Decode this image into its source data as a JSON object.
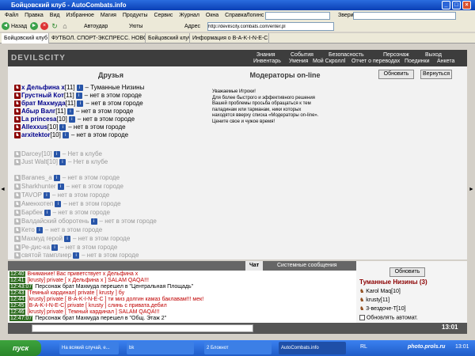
{
  "window": {
    "title": "Бойцовский клуб - AutoCombats.info"
  },
  "menu": [
    "Файл",
    "Правка",
    "Вид",
    "Избранное",
    "Магия",
    "Продукты",
    "Сервис",
    "Журнал",
    "Окна",
    "Справка"
  ],
  "toolbar": {
    "back": "Назад",
    "autoheroes": "Автоудар",
    "utoty": "Уюты",
    "address_label": "Адрес",
    "address_value": "http://devilscity.combats.com/enter.pl",
    "logins_label": "Логинс",
    "zveri_label": "Звери:"
  },
  "tabs": [
    "Бойцовский клуб",
    "ФУТБОЛ. СПОРТ-ЭКСПРЕСС. НОВОС...",
    "Бойцовский клуб",
    "Информация о B-A-K-I-N-E-C"
  ],
  "game": {
    "logo": "DEVILSCITY",
    "nav_top": [
      "Знания",
      "События",
      "Безопасность",
      "Персонаж",
      "Выход"
    ],
    "nav_bottom": [
      "Инвентарь",
      "Умения",
      "Мой Скроллl",
      "Отчет о переводах",
      "Поединки",
      "Анкета"
    ],
    "refresh": "Обновить",
    "back": "Вернуться",
    "friends_title": "Друзья",
    "moderators_title": "Модераторы on-line",
    "moderators_text": [
      "Уважаемые Игроки!",
      "Для более быстрого и эффективного решения",
      "Вашей проблемы просьба обращаться к тем",
      "паладинам или тарманам, ники которых",
      "находятся вверху списка «Модераторы on-line».",
      "Цените свое и чужое время!"
    ],
    "friends": [
      {
        "name": "x Дельфина x",
        "level": "[11]",
        "status": "– Туманные Низины",
        "online": true
      },
      {
        "name": "Грустный Кот",
        "level": "[11]",
        "status": "– нет в этом городе",
        "online": true
      },
      {
        "name": "брат Махмуда",
        "level": "[11]",
        "status": "– нет в этом городе",
        "online": true
      },
      {
        "name": "Абыр Валг",
        "level": "[11]",
        "status": "– нет в этом городе",
        "online": true
      },
      {
        "name": "La princesa",
        "level": "[10]",
        "status": "– нет в этом городе",
        "online": true
      },
      {
        "name": "Allexxus",
        "level": "[10]",
        "status": "– нет в этом городе",
        "online": true
      },
      {
        "name": "arxitektor",
        "level": "[10]",
        "status": "– нет в этом городе",
        "online": true
      },
      {
        "name": "Darcey",
        "level": "[10]",
        "status": "– Нет в клубе",
        "online": false
      },
      {
        "name": "Just Walt",
        "level": "[10]",
        "status": "– Нет в клубе",
        "online": false
      },
      {
        "name": "Baranes_a",
        "level": "",
        "status": "– нет в этом городе",
        "online": false
      },
      {
        "name": "Sharkhunter",
        "level": "",
        "status": "– нет в этом городе",
        "online": false
      },
      {
        "name": "TAVOP",
        "level": "",
        "status": "– нет в этом городе",
        "online": false
      },
      {
        "name": "Аменхотеп",
        "level": "",
        "status": "– нет в этом городе",
        "online": false
      },
      {
        "name": "Барбек",
        "level": "",
        "status": "– нет в этом городе",
        "online": false
      },
      {
        "name": "Валдайский оборотень",
        "level": "",
        "status": "– нет в этом городе",
        "online": false
      },
      {
        "name": "Кето",
        "level": "",
        "status": "– нет в этом городе",
        "online": false
      },
      {
        "name": "Махмуд герой",
        "level": "",
        "status": "– нет в этом городе",
        "online": false
      },
      {
        "name": "Ре-дис-ка",
        "level": "",
        "status": "– нет в этом городе",
        "online": false
      },
      {
        "name": "святой тамплиер",
        "level": "",
        "status": "– нет в этом городе",
        "online": false
      }
    ]
  },
  "chat": {
    "tabs": [
      "Чат",
      "Системные сообщения"
    ],
    "lines": [
      {
        "time": "12:40",
        "text": "Внимание! Вас приветствует x Дельфина x"
      },
      {
        "time": "12:41",
        "text": "[krusty] private [ x Дельфина x ] SALAM QAQA!!!"
      },
      {
        "time": "12:43:07",
        "text": "Персонаж брат Махмуда перешел в \"Центральная Площадь\""
      },
      {
        "time": "12:43",
        "text": "[Темный кардинал] private [ krusty ] бу"
      },
      {
        "time": "12:44",
        "text": "[krusty] private [ B-A-K-I-N-E-C ] ти миз долгин камаз баклавам!!! мек!"
      },
      {
        "time": "12:45",
        "text": "[B-A-K-I-N-E-C] private [ krusty ] слинь с привата.дебил"
      },
      {
        "time": "12:46",
        "text": "[krusty] private [ Темный кардинал ] SALAM QAQA!!!"
      },
      {
        "time": "12:47:07",
        "text": "Персонаж брат Махмуда перешел в \"Общ. Этаж 2\""
      }
    ]
  },
  "room": {
    "refresh": "Обновить",
    "title": "Туманные Низины (3)",
    "users": [
      "Karol Maq[10]",
      "krusty[11]",
      "3-вездоче-Т[10]"
    ],
    "autorefresh": "Обновлять автомат."
  },
  "clock": "13:01",
  "taskbar": {
    "start": "пуск",
    "tasks": [
      "На всякий случай, е...",
      "bk",
      "2 Блокнот",
      "AutoCombats.info"
    ],
    "lang": "RL",
    "brand": "photo.prols.ru",
    "time": "13:01"
  }
}
